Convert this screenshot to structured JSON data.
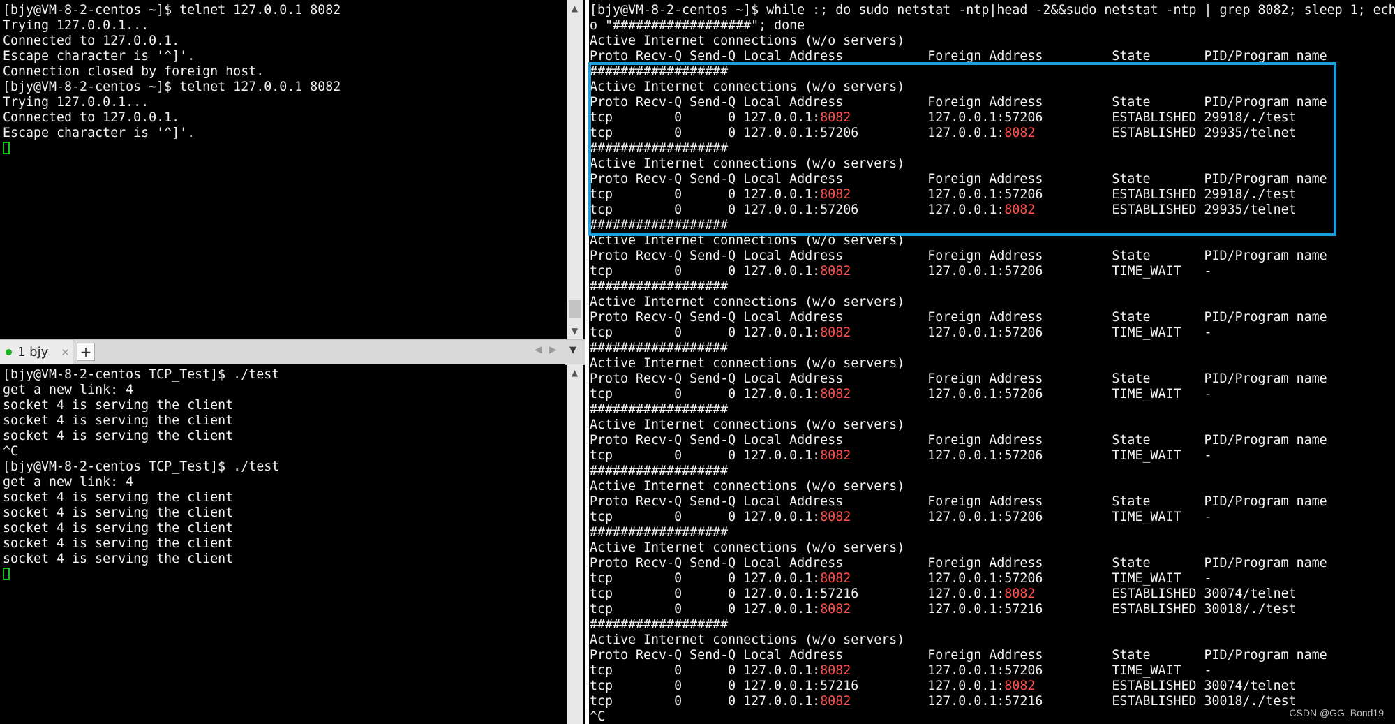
{
  "top_left_terminal": {
    "lines": [
      "[bjy@VM-8-2-centos ~]$ telnet 127.0.0.1 8082",
      "Trying 127.0.0.1...",
      "Connected to 127.0.0.1.",
      "Escape character is '^]'.",
      "Connection closed by foreign host.",
      "[bjy@VM-8-2-centos ~]$ telnet 127.0.0.1 8082",
      "Trying 127.0.0.1...",
      "Connected to 127.0.0.1.",
      "Escape character is '^]'."
    ]
  },
  "bottom_left_terminal": {
    "lines": [
      "[bjy@VM-8-2-centos TCP_Test]$ ./test",
      "get a new link: 4",
      "socket 4 is serving the client",
      "socket 4 is serving the client",
      "socket 4 is serving the client",
      "^C",
      "[bjy@VM-8-2-centos TCP_Test]$ ./test",
      "get a new link: 4",
      "socket 4 is serving the client",
      "socket 4 is serving the client",
      "socket 4 is serving the client",
      "socket 4 is serving the client",
      "socket 4 is serving the client"
    ]
  },
  "tab_bar": {
    "tab_label": "1 bjy",
    "close_glyph": "✕",
    "add_glyph": "+",
    "prev_glyph": "◀",
    "next_glyph": "▶",
    "menu_glyph": "▼",
    "active_dot_color": "#1fb21f"
  },
  "right_terminal": {
    "lines": [
      "[bjy@VM-8-2-centos ~]$ while :; do sudo netstat -ntp|head -2&&sudo netstat -ntp | grep 8082; sleep 1; ech",
      "o \"##################\"; done",
      "Active Internet connections (w/o servers)",
      "Proto Recv-Q Send-Q Local Address           Foreign Address         State       PID/Program name",
      "##################",
      "Active Internet connections (w/o servers)",
      "Proto Recv-Q Send-Q Local Address           Foreign Address         State       PID/Program name",
      "tcp        0      0 127.0.0.1:{8082}          127.0.0.1:57206         ESTABLISHED 29918/./test",
      "tcp        0      0 127.0.0.1:57206         127.0.0.1:{8082}          ESTABLISHED 29935/telnet",
      "##################",
      "Active Internet connections (w/o servers)",
      "Proto Recv-Q Send-Q Local Address           Foreign Address         State       PID/Program name",
      "tcp        0      0 127.0.0.1:{8082}          127.0.0.1:57206         ESTABLISHED 29918/./test",
      "tcp        0      0 127.0.0.1:57206         127.0.0.1:{8082}          ESTABLISHED 29935/telnet",
      "##################",
      "Active Internet connections (w/o servers)",
      "Proto Recv-Q Send-Q Local Address           Foreign Address         State       PID/Program name",
      "tcp        0      0 127.0.0.1:{8082}          127.0.0.1:57206         TIME_WAIT   -",
      "##################",
      "Active Internet connections (w/o servers)",
      "Proto Recv-Q Send-Q Local Address           Foreign Address         State       PID/Program name",
      "tcp        0      0 127.0.0.1:{8082}          127.0.0.1:57206         TIME_WAIT   -",
      "##################",
      "Active Internet connections (w/o servers)",
      "Proto Recv-Q Send-Q Local Address           Foreign Address         State       PID/Program name",
      "tcp        0      0 127.0.0.1:{8082}          127.0.0.1:57206         TIME_WAIT   -",
      "##################",
      "Active Internet connections (w/o servers)",
      "Proto Recv-Q Send-Q Local Address           Foreign Address         State       PID/Program name",
      "tcp        0      0 127.0.0.1:{8082}          127.0.0.1:57206         TIME_WAIT   -",
      "##################",
      "Active Internet connections (w/o servers)",
      "Proto Recv-Q Send-Q Local Address           Foreign Address         State       PID/Program name",
      "tcp        0      0 127.0.0.1:{8082}          127.0.0.1:57206         TIME_WAIT   -",
      "##################",
      "Active Internet connections (w/o servers)",
      "Proto Recv-Q Send-Q Local Address           Foreign Address         State       PID/Program name",
      "tcp        0      0 127.0.0.1:{8082}          127.0.0.1:57206         TIME_WAIT   -",
      "tcp        0      0 127.0.0.1:57216         127.0.0.1:{8082}          ESTABLISHED 30074/telnet",
      "tcp        0      0 127.0.0.1:{8082}          127.0.0.1:57216         ESTABLISHED 30018/./test",
      "##################",
      "Active Internet connections (w/o servers)",
      "Proto Recv-Q Send-Q Local Address           Foreign Address         State       PID/Program name",
      "tcp        0      0 127.0.0.1:{8082}          127.0.0.1:57206         TIME_WAIT   -",
      "tcp        0      0 127.0.0.1:57216         127.0.0.1:{8082}          ESTABLISHED 30074/telnet",
      "tcp        0      0 127.0.0.1:{8082}          127.0.0.1:57216         ESTABLISHED 30018/./test",
      "^C"
    ]
  },
  "colors": {
    "port_highlight": "#ff4f4f",
    "highlight_box": "#1aa0de",
    "cursor": "#19c119"
  },
  "watermark": "CSDN @GG_Bond19"
}
